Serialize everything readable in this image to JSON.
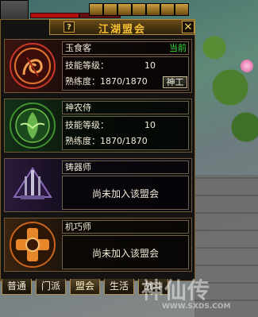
{
  "window": {
    "title": "江湖盟会",
    "help_label": "?",
    "close_label": "✕"
  },
  "labels": {
    "skill_level": "技能等级：",
    "proficiency": "熟练度：",
    "not_joined": "尚未加入该盟会"
  },
  "guilds": [
    {
      "name": "玉食客",
      "status": "当前",
      "level": "10",
      "proficiency": "1870/1870",
      "button": "神工",
      "emblem": "red-dragon-emblem-icon"
    },
    {
      "name": "神农侍",
      "level": "10",
      "proficiency": "1870/1870",
      "emblem": "green-herb-emblem-icon"
    },
    {
      "name": "铸器师",
      "joined": false,
      "emblem": "purple-weapons-emblem-icon"
    },
    {
      "name": "机巧师",
      "joined": false,
      "emblem": "orange-gear-emblem-icon"
    }
  ],
  "tabs": [
    "普通",
    "门派",
    "盟会",
    "生活",
    "战斗"
  ],
  "active_tab": "盟会",
  "watermark": {
    "text": "神仙传",
    "url": "WWW.SXDS.COM"
  },
  "colors": {
    "title": "#f6c232",
    "status_current": "#3adf3a",
    "frame": "#b48a3a"
  }
}
